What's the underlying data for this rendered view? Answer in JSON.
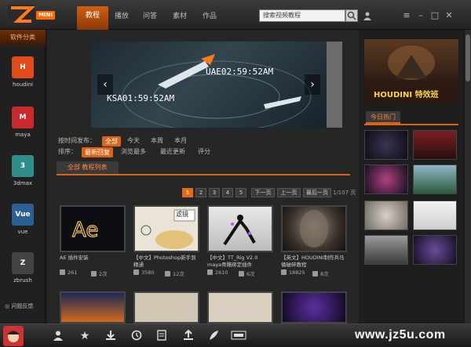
{
  "topbar": {
    "logo_badge": "MINI",
    "tabs": [
      "教程",
      "播放",
      "问答",
      "素材",
      "作品"
    ],
    "search": {
      "value": "搜索视频教程",
      "placeholder": ""
    }
  },
  "sidebar": {
    "title": "软件分类",
    "items": [
      {
        "label": "houdini",
        "icon": "houdini-icon",
        "color": "#e2491b",
        "glyph": "H"
      },
      {
        "label": "maya",
        "icon": "maya-icon",
        "color": "#c9282d",
        "glyph": "M"
      },
      {
        "label": "3dmax",
        "icon": "3dmax-icon",
        "color": "#2f8d8a",
        "glyph": "3"
      },
      {
        "label": "vue",
        "icon": "vue-icon",
        "color": "#2e5f93",
        "glyph": "Vue"
      },
      {
        "label": "zbrush",
        "icon": "zbrush-icon",
        "color": "#444444",
        "glyph": "Z"
      }
    ],
    "feedback": "问题反馈"
  },
  "banner": {
    "text_top": "UAE02:59:52AM",
    "text_bottom": "KSA01:59:52AM"
  },
  "filters": {
    "time_label": "按时间发布：",
    "time_options": [
      "全部",
      "今天",
      "本周",
      "本月"
    ],
    "sort_label": "排序：",
    "sort_options": [
      "最新回复",
      "浏览最多",
      "最近更新",
      "评分"
    ]
  },
  "list_tab": "全部 教程列表",
  "pager": {
    "pages": [
      "1",
      "2",
      "3",
      "4",
      "5"
    ],
    "next": "下一页",
    "prev": "上一页",
    "last": "最后一页",
    "count": "1/107 页"
  },
  "cards": [
    {
      "title": "AE 插件安装",
      "views": "261",
      "plays": "2次"
    },
    {
      "title": "【中文】Photoshop新手到精通",
      "views": "3580",
      "plays": "12次"
    },
    {
      "title": "【中文】TT_Rig V2.0 maya骨骼绑定插件",
      "views": "2610",
      "plays": "6次"
    },
    {
      "title": "【英文】HOUDINI制作兵马俑破碎教程",
      "views": "18825",
      "plays": "8次"
    }
  ],
  "card2_thumb_text": "滤镜",
  "right": {
    "promo_text": "HOUDINI 特效班",
    "hot_title": "今日热门"
  },
  "watermark": "www.jz5u.com",
  "colors": {
    "accent": "#d8641a",
    "background": "#1b1b1b"
  }
}
